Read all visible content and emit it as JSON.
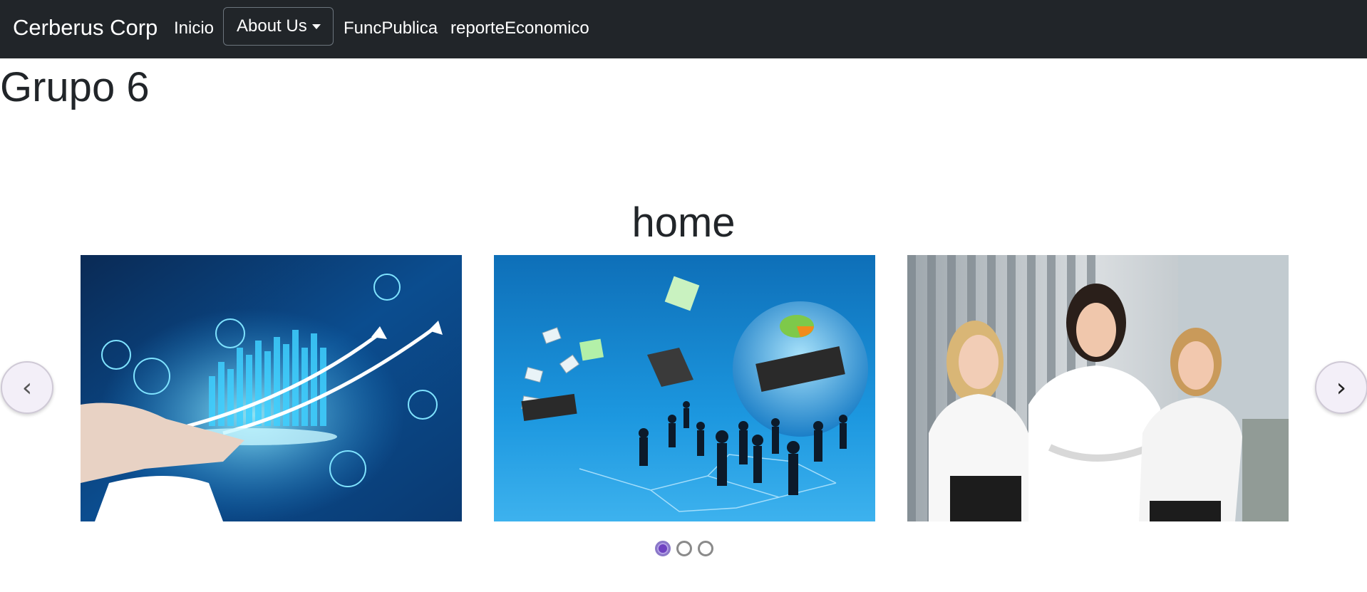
{
  "navbar": {
    "brand": "Cerberus Corp",
    "links": {
      "inicio": "Inicio",
      "about": "About Us",
      "func": "FuncPublica",
      "reporte": "reporteEconomico"
    }
  },
  "page": {
    "title": "Grupo 6"
  },
  "carousel": {
    "title": "home",
    "prev_glyph": "‹",
    "next_glyph": "›",
    "slides": [
      {
        "icon": "business-analytics-image"
      },
      {
        "icon": "global-network-image"
      },
      {
        "icon": "businesswomen-team-image"
      }
    ],
    "active_indicator": 1,
    "indicator_count": 3
  },
  "colors": {
    "navbar_bg": "#212529",
    "accent": "#6f42c1"
  }
}
